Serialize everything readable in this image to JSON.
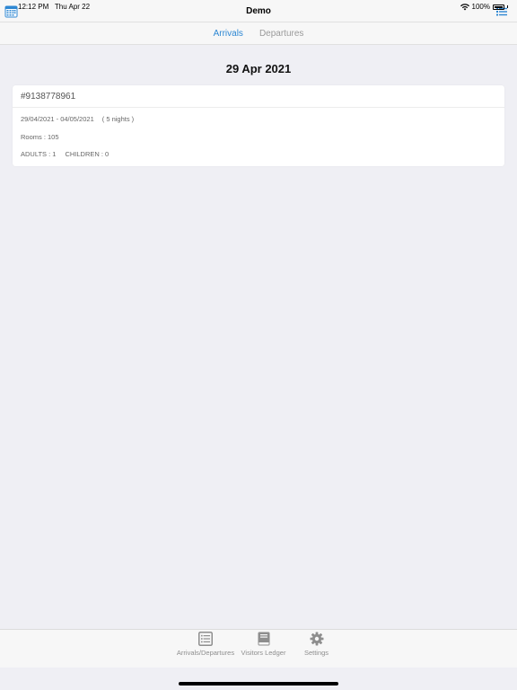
{
  "status_bar": {
    "time": "12:12 PM",
    "date": "Thu Apr 22",
    "battery": "100%"
  },
  "nav": {
    "title": "Demo",
    "left_icon": "calendar-icon",
    "right_icon": "list-icon"
  },
  "segments": {
    "arrivals": "Arrivals",
    "departures": "Departures",
    "active": "Arrivals"
  },
  "date_header": "29 Apr 2021",
  "bookings": [
    {
      "id": "#9138778961",
      "dates": "29/04/2021 - 04/05/2021",
      "nights": "( 5 nights )",
      "rooms": "Rooms : 105",
      "adults": "ADULTS : 1",
      "children": "CHILDREN : 0"
    }
  ],
  "tabs": [
    {
      "label": "Arrivals/Departures",
      "icon": "list-icon"
    },
    {
      "label": "Visitors Ledger",
      "icon": "book-icon"
    },
    {
      "label": "Settings",
      "icon": "gear-icon"
    }
  ],
  "colors": {
    "accent": "#2d87d3",
    "background": "#efeff4",
    "tab_gray": "#8e8e8e"
  }
}
